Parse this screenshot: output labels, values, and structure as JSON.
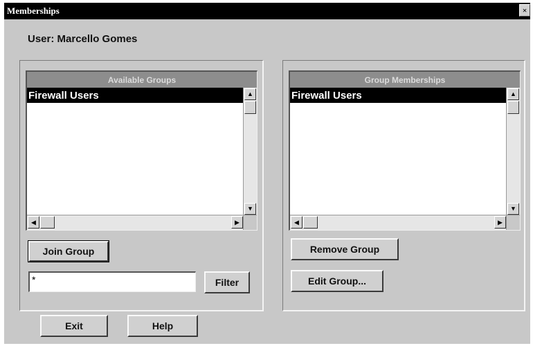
{
  "window": {
    "title": "Memberships",
    "close_label": "×"
  },
  "user_label": "User: Marcello Gomes",
  "available_groups": {
    "header": "Available Groups",
    "items": [
      "Firewall Users"
    ],
    "join_button": "Join Group",
    "filter_value": "*",
    "filter_button": "Filter"
  },
  "group_memberships": {
    "header": "Group Memberships",
    "items": [
      "Firewall Users"
    ],
    "remove_button": "Remove Group",
    "edit_button": "Edit Group..."
  },
  "footer": {
    "exit_button": "Exit",
    "help_button": "Help"
  },
  "icons": {
    "up": "▲",
    "down": "▼",
    "left": "◀",
    "right": "▶"
  }
}
